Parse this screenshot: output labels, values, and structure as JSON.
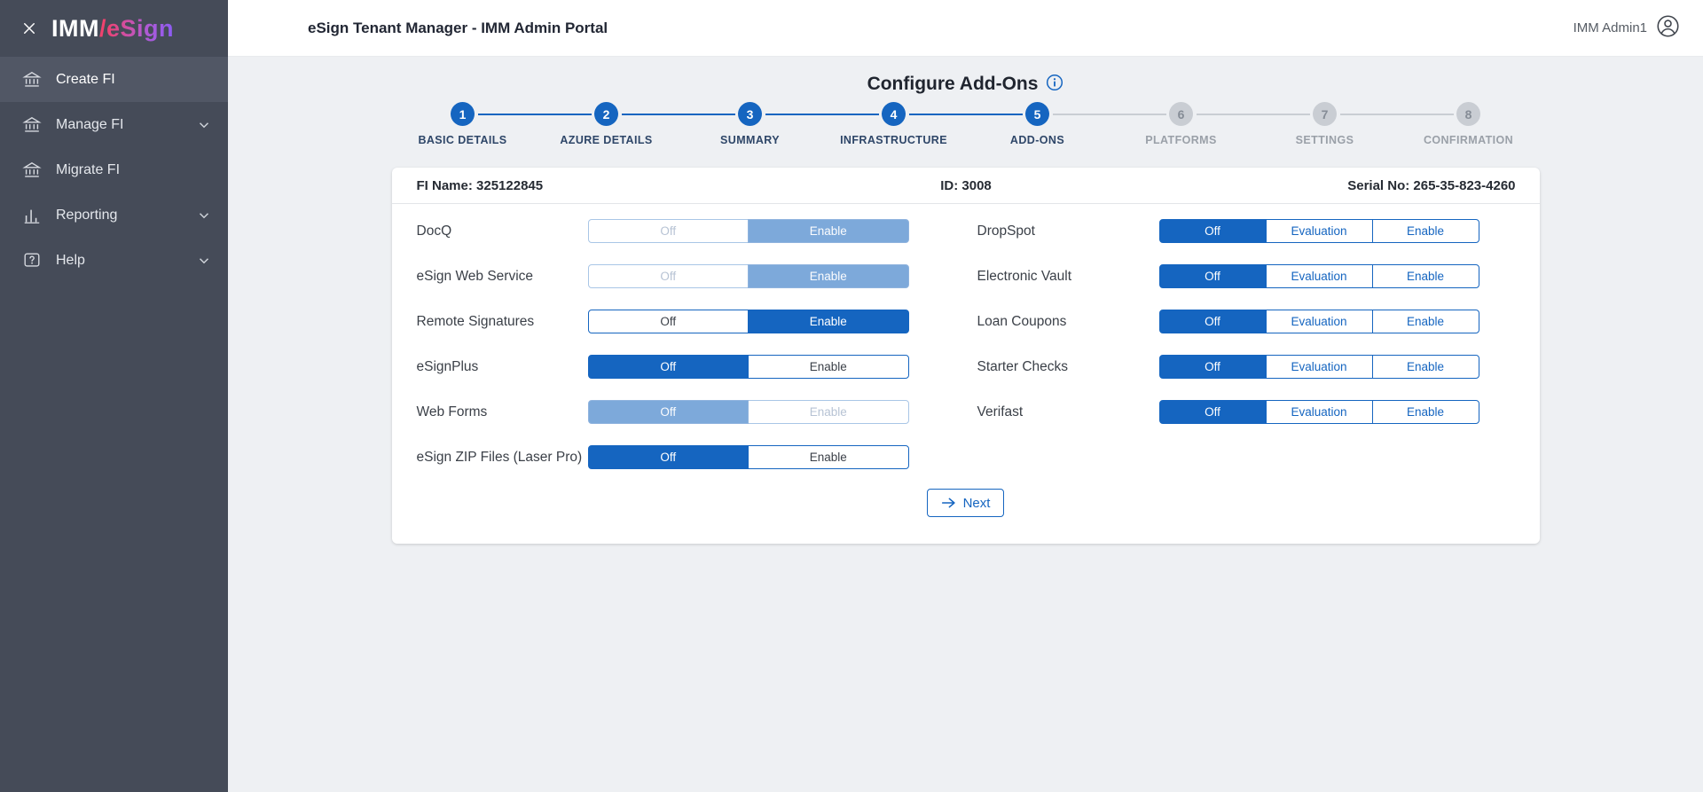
{
  "colors": {
    "accent_blue": "#1565c0",
    "disabled_blue": "#7da9da",
    "sidebar_bg": "#454b58"
  },
  "sidebar": {
    "logo_imm": "IMM",
    "logo_esign": "/eSign",
    "items": [
      {
        "label": "Create FI"
      },
      {
        "label": "Manage FI"
      },
      {
        "label": "Migrate FI"
      },
      {
        "label": "Reporting"
      },
      {
        "label": "Help"
      }
    ]
  },
  "header": {
    "title": "eSign Tenant Manager - IMM Admin Portal",
    "user_name": "IMM Admin1"
  },
  "main": {
    "title": "Configure Add-Ons",
    "steps": [
      {
        "num": "1",
        "label": "BASIC DETAILS",
        "state": "done"
      },
      {
        "num": "2",
        "label": "AZURE DETAILS",
        "state": "done"
      },
      {
        "num": "3",
        "label": "SUMMARY",
        "state": "done"
      },
      {
        "num": "4",
        "label": "INFRASTRUCTURE",
        "state": "done"
      },
      {
        "num": "5",
        "label": "ADD-ONS",
        "state": "active"
      },
      {
        "num": "6",
        "label": "PLATFORMS",
        "state": "future"
      },
      {
        "num": "7",
        "label": "SETTINGS",
        "state": "future"
      },
      {
        "num": "8",
        "label": "CONFIRMATION",
        "state": "future"
      }
    ],
    "card": {
      "fi_name": "FI Name: 325122845",
      "id": "ID: 3008",
      "serial": "Serial No: 265-35-823-4260",
      "left_addons": [
        {
          "name": "DocQ",
          "options": [
            "Off",
            "Enable"
          ],
          "selected": "Enable",
          "disabled": true
        },
        {
          "name": "eSign Web Service",
          "options": [
            "Off",
            "Enable"
          ],
          "selected": "Enable",
          "disabled": true
        },
        {
          "name": "Remote Signatures",
          "options": [
            "Off",
            "Enable"
          ],
          "selected": "Enable",
          "disabled": false
        },
        {
          "name": "eSignPlus",
          "options": [
            "Off",
            "Enable"
          ],
          "selected": "Off",
          "disabled": false
        },
        {
          "name": "Web Forms",
          "options": [
            "Off",
            "Enable"
          ],
          "selected": "Off",
          "disabled": true
        },
        {
          "name": "eSign ZIP Files (Laser Pro)",
          "options": [
            "Off",
            "Enable"
          ],
          "selected": "Off",
          "disabled": false
        }
      ],
      "right_addons": [
        {
          "name": "DropSpot",
          "options": [
            "Off",
            "Evaluation",
            "Enable"
          ],
          "selected": "Off"
        },
        {
          "name": "Electronic Vault",
          "options": [
            "Off",
            "Evaluation",
            "Enable"
          ],
          "selected": "Off"
        },
        {
          "name": "Loan Coupons",
          "options": [
            "Off",
            "Evaluation",
            "Enable"
          ],
          "selected": "Off"
        },
        {
          "name": "Starter Checks",
          "options": [
            "Off",
            "Evaluation",
            "Enable"
          ],
          "selected": "Off"
        },
        {
          "name": "Verifast",
          "options": [
            "Off",
            "Evaluation",
            "Enable"
          ],
          "selected": "Off"
        }
      ],
      "next_label": "Next"
    }
  }
}
